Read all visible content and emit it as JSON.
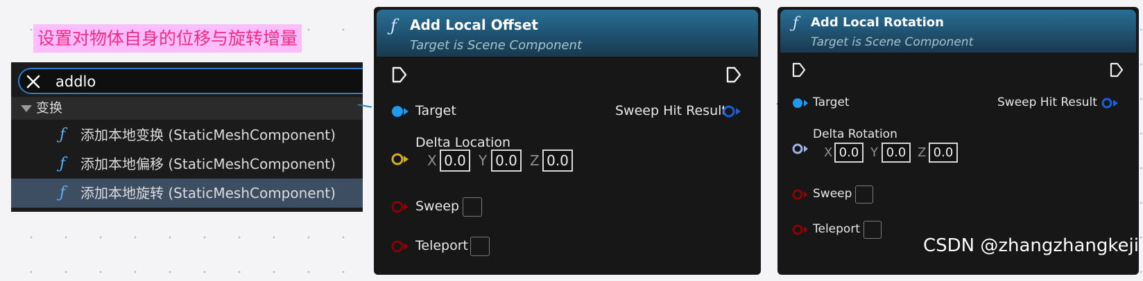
{
  "annotation": {
    "text": "设置对物体自身的位移与旋转增量"
  },
  "search_panel": {
    "query": "addlo",
    "category": "变换",
    "function_glyph": "ƒ",
    "results": [
      {
        "label": "添加本地变换 (StaticMeshComponent)"
      },
      {
        "label": "添加本地偏移 (StaticMeshComponent)"
      },
      {
        "label": "添加本地旋转 (StaticMeshComponent)"
      }
    ],
    "selected_index": 2
  },
  "node_offset": {
    "title": "Add Local Offset",
    "subtitle": "Target is Scene Component",
    "function_glyph": "ƒ",
    "pins": {
      "target": "Target",
      "output": "Sweep Hit Result",
      "delta": "Delta Location",
      "sweep": "Sweep",
      "teleport": "Teleport"
    },
    "vector": {
      "x_label": "X",
      "x": "0.0",
      "y_label": "Y",
      "y": "0.0",
      "z_label": "Z",
      "z": "0.0"
    }
  },
  "node_rotation": {
    "title": "Add Local Rotation",
    "subtitle": "Target is Scene Component",
    "function_glyph": "ƒ",
    "pins": {
      "target": "Target",
      "output": "Sweep Hit Result",
      "delta": "Delta Rotation",
      "sweep": "Sweep",
      "teleport": "Teleport"
    },
    "vector": {
      "x_label": "X",
      "x": "0.0",
      "y_label": "Y",
      "y": "0.0",
      "z_label": "Z",
      "z": "0.0"
    }
  },
  "watermark": {
    "text": "CSDN @zhangzhangkeji"
  },
  "colors": {
    "annotation_bg": "#fdbdfb",
    "annotation_text": "#ef2b86",
    "object_pin": "#1e9af0",
    "vector_pin": "#d6b01e",
    "rotator_pin": "#9fb3e8",
    "bool_pin": "#8b0000",
    "header": "#215676",
    "selected_row": "#3e4e62"
  }
}
